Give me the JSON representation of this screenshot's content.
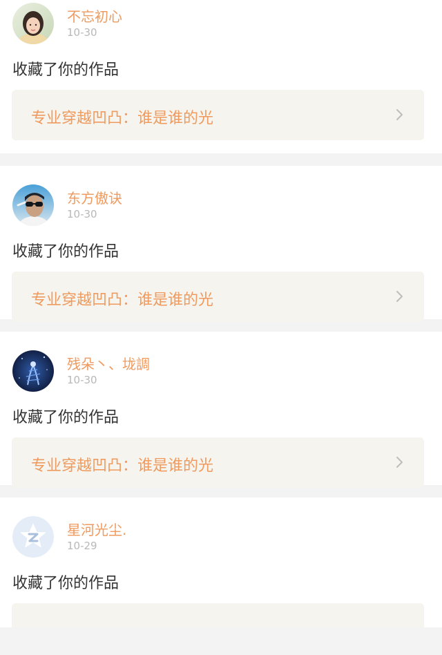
{
  "feed": {
    "items": [
      {
        "user_name": "不忘初心",
        "date": "10-30",
        "action": "收藏了你的作品",
        "work_title": "专业穿越凹凸：谁是谁的光",
        "avatar": "female-portrait-photo"
      },
      {
        "user_name": "东方傲诀",
        "date": "10-30",
        "action": "收藏了你的作品",
        "work_title": "专业穿越凹凸：谁是谁的光",
        "avatar": "sunglasses-portrait-photo"
      },
      {
        "user_name": "残朵丶、垅調",
        "date": "10-30",
        "action": "收藏了你的作品",
        "work_title": "专业穿越凹凸：谁是谁的光",
        "avatar": "blue-night-art-photo"
      },
      {
        "user_name": "星河光尘.",
        "date": "10-29",
        "action": "收藏了你的作品",
        "work_title": "",
        "avatar": "default-qq-star-avatar"
      }
    ]
  },
  "colors": {
    "accent": "#ef9a5e",
    "card_bg": "#ffffff",
    "page_bg": "#f3f3f3",
    "work_bg": "#f5f4ee",
    "meta_text": "#b8b8b8",
    "body_text": "#333333"
  },
  "icons": {
    "chevron": "chevron-right-icon"
  }
}
